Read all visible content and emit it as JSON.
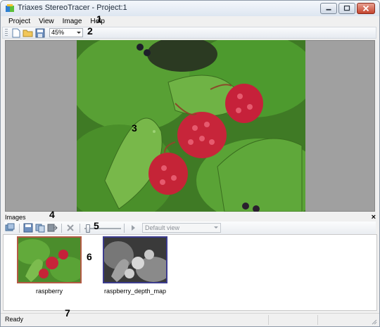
{
  "window": {
    "title": "Triaxes StereoTracer - Project:1"
  },
  "menu": {
    "items": [
      "Project",
      "View",
      "Image",
      "Help"
    ]
  },
  "toolbar": {
    "buttons": [
      "new-project",
      "open-project",
      "save-project"
    ],
    "zoom_value": "45%"
  },
  "images_panel": {
    "title": "Images",
    "close_label": "×",
    "view_select": "Default view",
    "items": [
      {
        "label": "raspberry",
        "selected": false
      },
      {
        "label": "raspberry_depth_map",
        "selected": true
      }
    ]
  },
  "status": {
    "text": "Ready"
  },
  "callouts": [
    "1",
    "2",
    "3",
    "4",
    "5",
    "6",
    "7"
  ],
  "colors": {
    "accent": "#3c3c8e",
    "thumb_border": "#b35a44"
  }
}
